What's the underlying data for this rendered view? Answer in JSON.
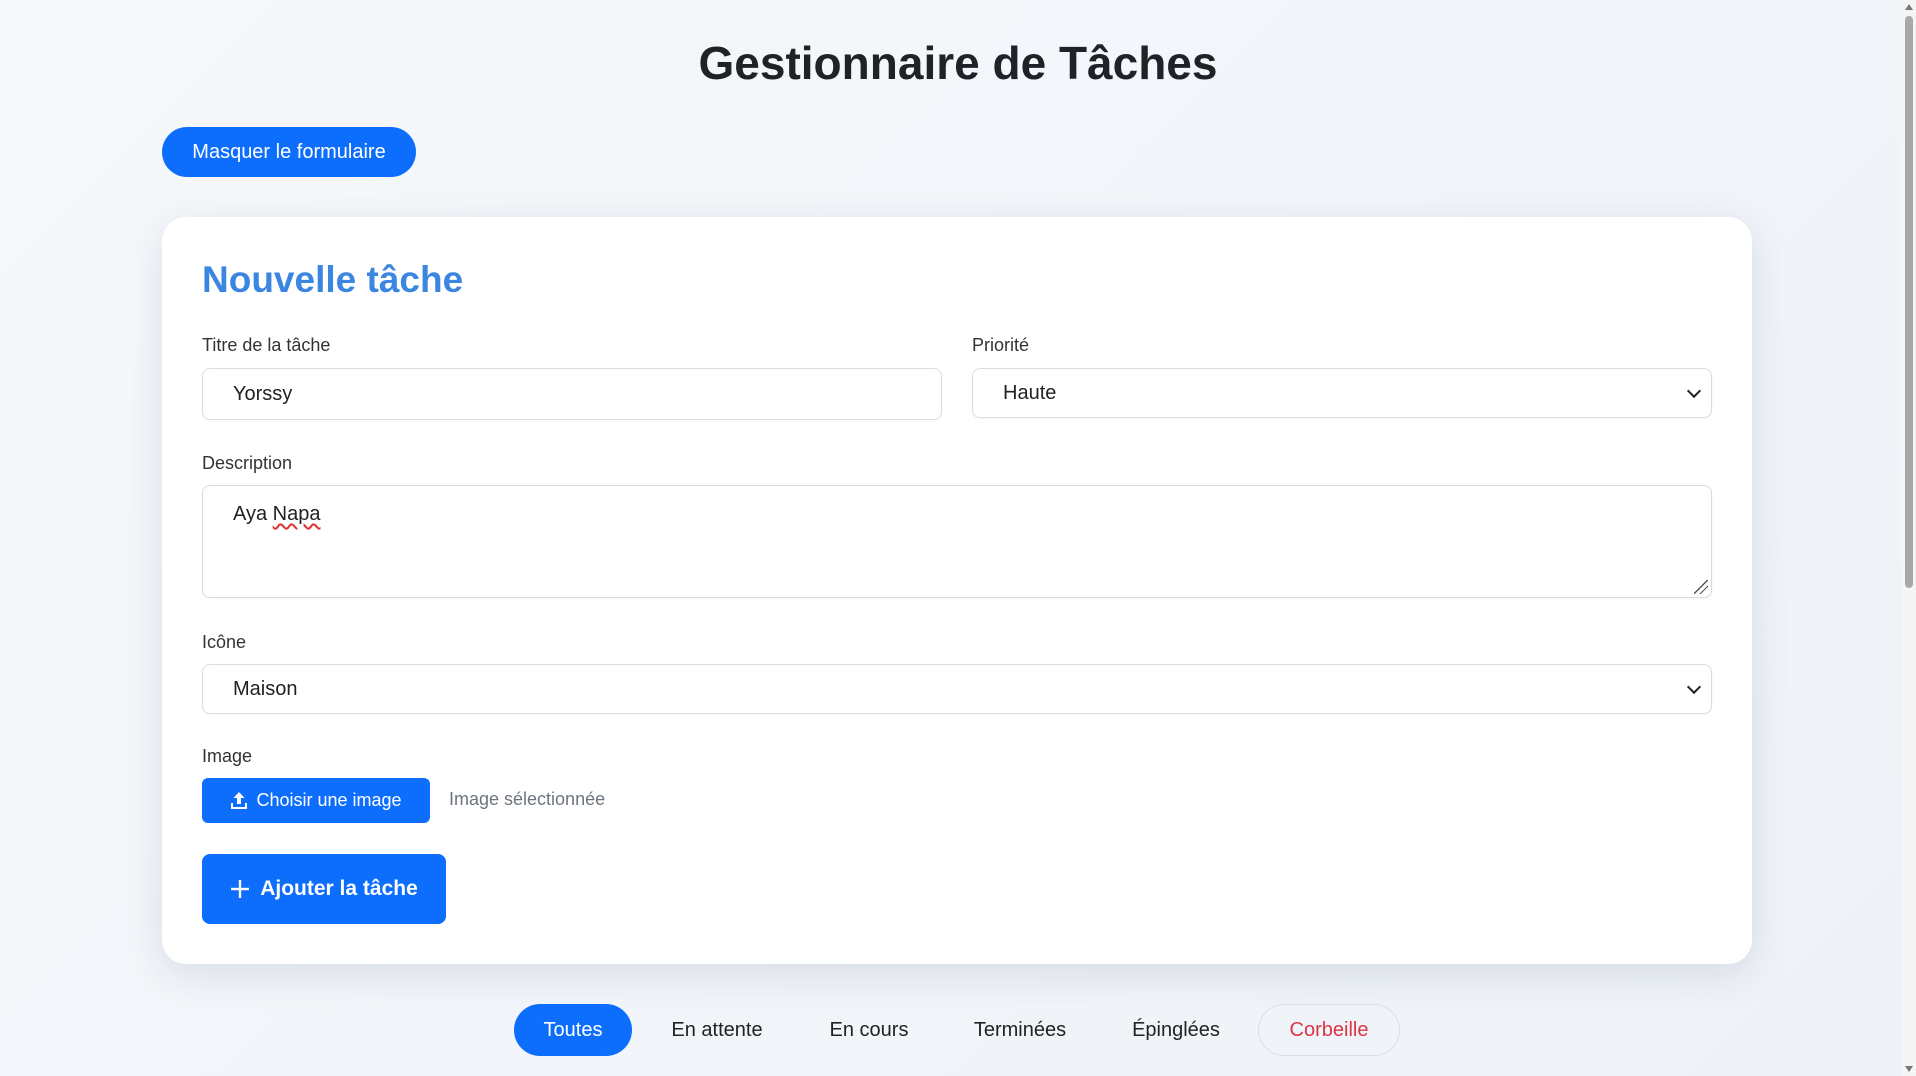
{
  "header": {
    "title": "Gestionnaire de Tâches",
    "toggle_form_label": "Masquer le formulaire"
  },
  "form": {
    "title": "Nouvelle tâche",
    "task_title": {
      "label": "Titre de la tâche",
      "value": "Yorssy"
    },
    "priority": {
      "label": "Priorité",
      "selected": "Haute"
    },
    "description": {
      "label": "Description",
      "value_word1": "Aya",
      "value_word2": "Napa"
    },
    "icon": {
      "label": "Icône",
      "selected": "Maison"
    },
    "image": {
      "label": "Image",
      "choose_button_label": "Choisir une image",
      "status_text": "Image sélectionnée",
      "button_icon": "upload-icon"
    },
    "submit": {
      "label": "Ajouter la tâche",
      "icon": "plus-icon"
    }
  },
  "filters": {
    "tabs": [
      {
        "label": "Toutes",
        "active": true
      },
      {
        "label": "En attente",
        "active": false
      },
      {
        "label": "En cours",
        "active": false
      },
      {
        "label": "Terminées",
        "active": false
      },
      {
        "label": "Épinglées",
        "active": false
      },
      {
        "label": "Corbeille",
        "active": false
      }
    ]
  },
  "colors": {
    "primary": "#0d6efd",
    "card_title": "#3a86e0",
    "trash_text": "#dc3545",
    "muted_text": "#6c757d"
  }
}
